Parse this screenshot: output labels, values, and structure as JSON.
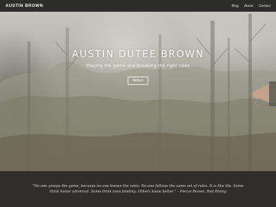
{
  "navbar": {
    "brand": "AUSTIN BROWN",
    "links": [
      {
        "label": "Blog"
      },
      {
        "label": "About"
      },
      {
        "label": "Contact"
      }
    ]
  },
  "hero": {
    "title": "AUSTIN DUTEE BROWN",
    "tagline": "Playing the game and breaking the right rules",
    "button_label": "Return"
  },
  "quote": {
    "text": "\"No one grasps the game, because no one knows the rules. No one follows the same set of rules. It is like life. Some think honor universal. Some think laws binding. Others know better.\" – Pierce Brown, Red Rising"
  },
  "colors": {
    "navbar_bg": "#1e1e1e",
    "footer_bg": "#2f2e2c",
    "text_light": "#ffffff"
  }
}
